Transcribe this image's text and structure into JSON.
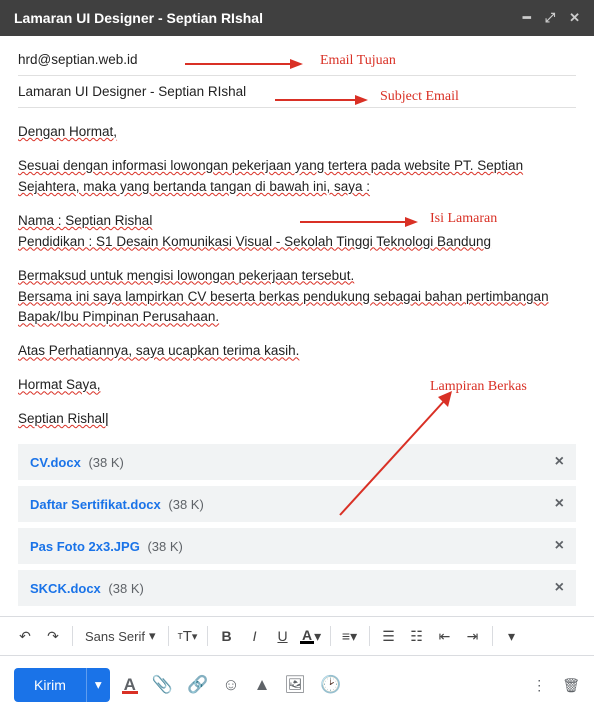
{
  "titlebar": {
    "title": "Lamaran UI Designer - Septian RIshal"
  },
  "recipient": "hrd@septian.web.id",
  "subject": "Lamaran UI Designer - Septian RIshal",
  "body": {
    "greeting": "Dengan Hormat,",
    "para1": "Sesuai dengan informasi lowongan pekerjaan yang tertera pada website PT. Septian Sejahtera, maka yang bertanda tangan di bawah ini, saya :",
    "name_line": "Nama : Septian Rishal",
    "edu_line": "Pendidikan : S1 Desain Komunikasi Visual - Sekolah Tinggi Teknologi Bandung",
    "para2a": "Bermaksud untuk mengisi lowongan pekerjaan tersebut.",
    "para2b": "Bersama ini saya lampirkan CV beserta berkas pendukung sebagai bahan pertimbangan Bapak/Ibu Pimpinan Perusahaan.",
    "thanks": "Atas Perhatiannya, saya ucapkan terima kasih.",
    "closing": "Hormat Saya,",
    "signature": "Septian Rishal"
  },
  "attachments": [
    {
      "name": "CV.docx",
      "size": "(38 K)"
    },
    {
      "name": "Daftar Sertifikat.docx",
      "size": "(38 K)"
    },
    {
      "name": "Pas Foto 2x3.JPG",
      "size": "(38 K)"
    },
    {
      "name": "SKCK.docx",
      "size": "(38 K)"
    }
  ],
  "toolbar": {
    "font": "Sans Serif"
  },
  "send_label": "Kirim",
  "annotations": {
    "to": "Email Tujuan",
    "subject": "Subject Email",
    "body": "Isi Lamaran",
    "attachments": "Lampiran Berkas"
  }
}
